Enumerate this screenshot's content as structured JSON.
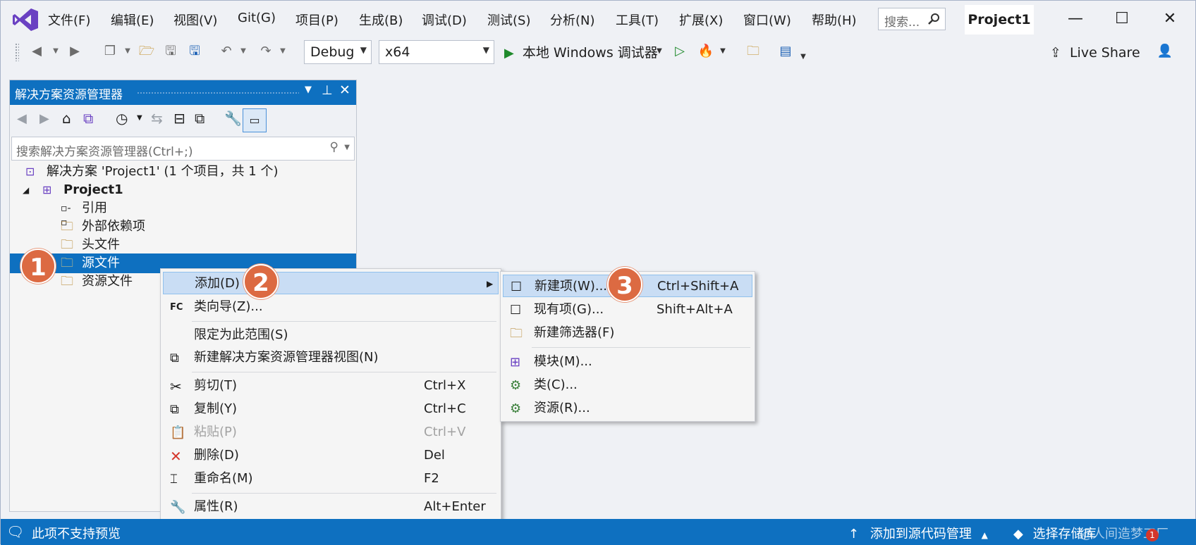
{
  "menu": [
    "文件(F)",
    "编辑(E)",
    "视图(V)",
    "Git(G)",
    "项目(P)",
    "生成(B)",
    "调试(D)",
    "测试(S)",
    "分析(N)",
    "工具(T)",
    "扩展(X)",
    "窗口(W)",
    "帮助(H)"
  ],
  "search": {
    "placeholder": "搜索...",
    "icon": "search-icon"
  },
  "window": {
    "project_title": "Project1",
    "minimize": "—",
    "maximize": "☐",
    "close": "✕"
  },
  "toolbar": {
    "config": "Debug",
    "platform": "x64",
    "run_label": "本地 Windows 调试器",
    "live_share": "Live Share",
    "colors": {
      "run": "#1f8a2b",
      "hot_reload": "#e8412c"
    }
  },
  "solution_explorer": {
    "title": "解决方案资源管理器",
    "search_placeholder": "搜索解决方案资源管理器(Ctrl+;)",
    "tree": [
      {
        "label": "解决方案 'Project1' (1 个项目，共 1 个)",
        "icon": "solution-icon"
      },
      {
        "label": "Project1",
        "icon": "project-icon",
        "expanded": true
      },
      {
        "label": "引用",
        "icon": "references-icon"
      },
      {
        "label": "外部依赖项",
        "icon": "external-deps-icon"
      },
      {
        "label": "头文件",
        "icon": "filter-folder-icon"
      },
      {
        "label": "源文件",
        "icon": "filter-folder-icon",
        "selected": true
      },
      {
        "label": "资源文件",
        "icon": "filter-folder-icon"
      }
    ]
  },
  "context_menu": {
    "items": [
      {
        "label": "添加(D)",
        "shortcut": "",
        "submenu": true,
        "highlighted": true
      },
      {
        "label": "类向导(Z)...",
        "shortcut": ""
      },
      {
        "label": "限定为此范围(S)",
        "shortcut": ""
      },
      {
        "label": "新建解决方案资源管理器视图(N)",
        "shortcut": ""
      },
      {
        "label": "剪切(T)",
        "shortcut": "Ctrl+X"
      },
      {
        "label": "复制(Y)",
        "shortcut": "Ctrl+C"
      },
      {
        "label": "粘贴(P)",
        "shortcut": "Ctrl+V",
        "disabled": true
      },
      {
        "label": "删除(D)",
        "shortcut": "Del"
      },
      {
        "label": "重命名(M)",
        "shortcut": "F2"
      },
      {
        "label": "属性(R)",
        "shortcut": "Alt+Enter"
      }
    ]
  },
  "submenu": {
    "items": [
      {
        "label": "新建项(W)...",
        "shortcut": "Ctrl+Shift+A",
        "highlighted": true
      },
      {
        "label": "现有项(G)...",
        "shortcut": "Shift+Alt+A"
      },
      {
        "label": "新建筛选器(F)",
        "shortcut": ""
      },
      {
        "label": "模块(M)...",
        "shortcut": ""
      },
      {
        "label": "类(C)...",
        "shortcut": ""
      },
      {
        "label": "资源(R)...",
        "shortcut": ""
      }
    ]
  },
  "badges": [
    "1",
    "2",
    "3"
  ],
  "status": {
    "left": "此项不支持预览",
    "source_control": "添加到源代码管理",
    "repo": "选择存储库",
    "watermark": "@人间造梦工厂"
  }
}
